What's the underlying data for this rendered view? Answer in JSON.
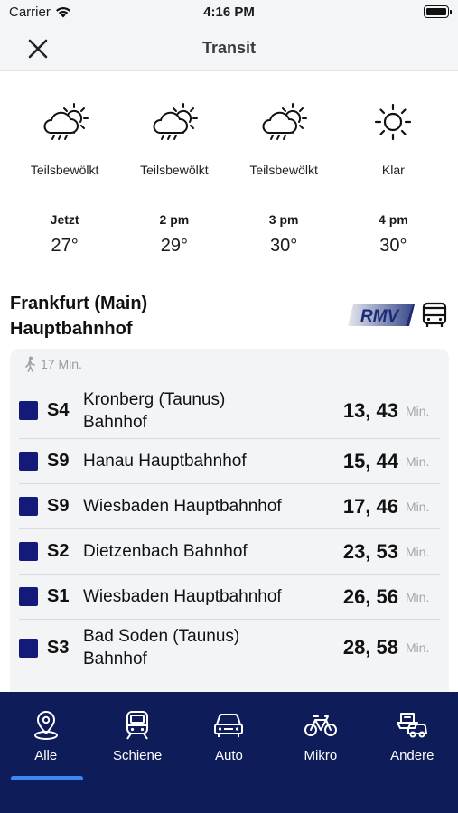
{
  "status": {
    "carrier": "Carrier",
    "time": "4:16 PM"
  },
  "header": {
    "title": "Transit"
  },
  "weather": [
    {
      "condition": "Teilsbewölkt",
      "time": "Jetzt",
      "temp": "27°",
      "icon": "partly-cloudy-icon"
    },
    {
      "condition": "Teilsbewölkt",
      "time": "2 pm",
      "temp": "29°",
      "icon": "partly-cloudy-icon"
    },
    {
      "condition": "Teilsbewölkt",
      "time": "3 pm",
      "temp": "30°",
      "icon": "partly-cloudy-icon"
    },
    {
      "condition": "Klar",
      "time": "4 pm",
      "temp": "30°",
      "icon": "sun-icon"
    }
  ],
  "station": {
    "line1": "Frankfurt (Main)",
    "line2": "Hauptbahnhof",
    "logo_text": "RMV"
  },
  "walk": {
    "duration": "17 Min."
  },
  "departures": [
    {
      "line": "S4",
      "dest1": "Kronberg (Taunus)",
      "dest2": "Bahnhof",
      "times": "13, 43",
      "unit": "Min."
    },
    {
      "line": "S9",
      "dest1": "Hanau Hauptbahnhof",
      "dest2": "",
      "times": "15, 44",
      "unit": "Min."
    },
    {
      "line": "S9",
      "dest1": "Wiesbaden Hauptbahnhof",
      "dest2": "",
      "times": "17, 46",
      "unit": "Min."
    },
    {
      "line": "S2",
      "dest1": "Dietzenbach Bahnhof",
      "dest2": "",
      "times": "23, 53",
      "unit": "Min."
    },
    {
      "line": "S1",
      "dest1": "Wiesbaden Hauptbahnhof",
      "dest2": "",
      "times": "26, 56",
      "unit": "Min."
    },
    {
      "line": "S3",
      "dest1": "Bad Soden (Taunus)",
      "dest2": "Bahnhof",
      "times": "28, 58",
      "unit": "Min."
    }
  ],
  "colors": {
    "line_square": "#131a7a",
    "nav_bg": "#0e1c5a",
    "nav_indicator": "#3d87f5"
  },
  "nav": [
    {
      "label": "Alle",
      "icon": "map-pin-icon",
      "active": true
    },
    {
      "label": "Schiene",
      "icon": "train-icon",
      "active": false
    },
    {
      "label": "Auto",
      "icon": "car-icon",
      "active": false
    },
    {
      "label": "Mikro",
      "icon": "bicycle-icon",
      "active": false
    },
    {
      "label": "Andere",
      "icon": "other-transport-icon",
      "active": false
    }
  ]
}
